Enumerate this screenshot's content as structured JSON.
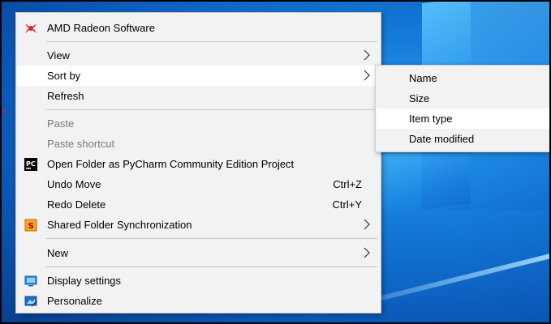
{
  "context_menu": {
    "items": [
      {
        "label": "AMD Radeon Software",
        "icon": "amd-radeon-icon"
      },
      {
        "label": "View",
        "submenu": true
      },
      {
        "label": "Sort by",
        "submenu": true,
        "highlighted": true
      },
      {
        "label": "Refresh"
      },
      {
        "label": "Paste",
        "disabled": true
      },
      {
        "label": "Paste shortcut",
        "disabled": true
      },
      {
        "label": "Open Folder as PyCharm Community Edition Project",
        "icon": "pycharm-icon"
      },
      {
        "label": "Undo Move",
        "shortcut": "Ctrl+Z"
      },
      {
        "label": "Redo Delete",
        "shortcut": "Ctrl+Y"
      },
      {
        "label": "Shared Folder Synchronization",
        "icon": "shared-folder-sync-icon",
        "submenu": true
      },
      {
        "label": "New",
        "submenu": true
      },
      {
        "label": "Display settings",
        "icon": "display-settings-icon"
      },
      {
        "label": "Personalize",
        "icon": "personalize-icon"
      }
    ]
  },
  "sort_submenu": {
    "items": [
      {
        "label": "Name"
      },
      {
        "label": "Size"
      },
      {
        "label": "Item type",
        "highlighted": true
      },
      {
        "label": "Date modified"
      }
    ]
  },
  "colors": {
    "menu_background": "#f2f2f2",
    "highlight": "#ffffff",
    "disabled_text": "#7a7a7a",
    "desktop_blue": "#0b59b8",
    "annotation_red": "#e21f26"
  }
}
